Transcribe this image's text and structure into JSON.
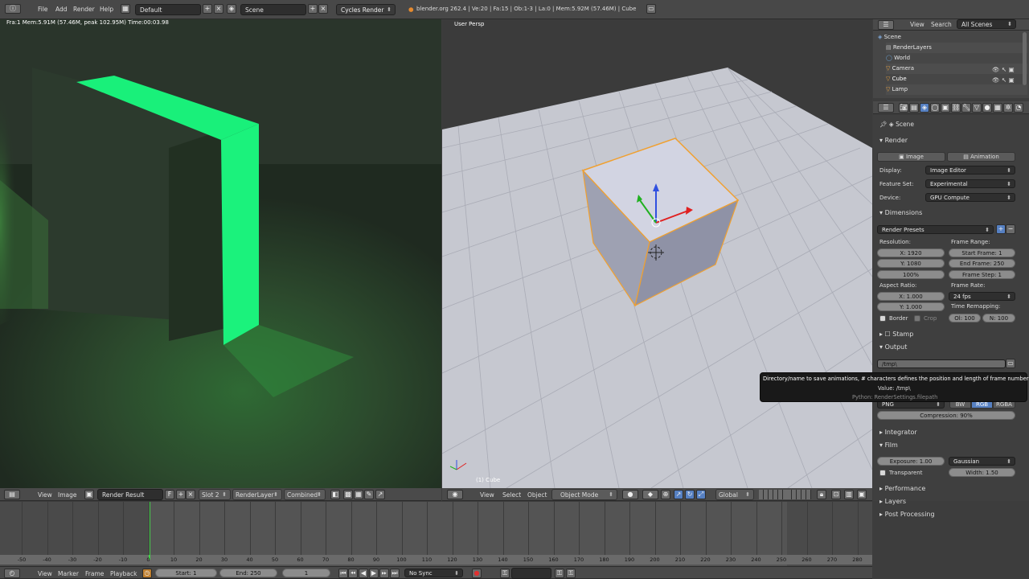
{
  "info_header": {
    "menus": [
      "File",
      "Add",
      "Render",
      "Help"
    ],
    "screen_layout": "Default",
    "scene": "Scene",
    "engine": "Cycles Render",
    "stats": "blender.org 262.4 | Ve:20 | Fa:15 | Ob:1-3 | La:0 | Mem:5.92M (57.46M) | Cube"
  },
  "image_editor": {
    "info_text": "Fra:1  Mem:5.91M (57.46M, peak 102.95M) Time:00:03.98",
    "menus": [
      "View",
      "Image"
    ],
    "image_name": "Render Result",
    "image_flag": "F",
    "slot": "Slot 2",
    "render_layer": "RenderLayer",
    "pass": "Combined"
  },
  "viewport": {
    "label": "User Persp",
    "object_label": "(1) Cube",
    "menus": [
      "View",
      "Select",
      "Object"
    ],
    "mode": "Object Mode",
    "orientation": "Global"
  },
  "outliner": {
    "menus": [
      "View",
      "Search"
    ],
    "filter": "All Scenes",
    "items": [
      "Scene",
      "RenderLayers",
      "World",
      "Camera",
      "Cube",
      "Lamp"
    ]
  },
  "properties": {
    "context": "Scene",
    "render": {
      "title": "Render",
      "image_btn": "Image",
      "animation_btn": "Animation",
      "display_label": "Display:",
      "display_value": "Image Editor",
      "feature_label": "Feature Set:",
      "feature_value": "Experimental",
      "device_label": "Device:",
      "device_value": "GPU Compute"
    },
    "dimensions": {
      "title": "Dimensions",
      "presets": "Render Presets",
      "resolution_label": "Resolution:",
      "res_x": "X: 1920",
      "res_y": "Y: 1080",
      "res_pct": "100%",
      "frame_range_label": "Frame Range:",
      "start_frame": "Start Frame: 1",
      "end_frame": "End Frame: 250",
      "frame_step": "Frame Step: 1",
      "aspect_label": "Aspect Ratio:",
      "aspect_x": "X: 1.000",
      "aspect_y": "Y: 1.000",
      "frame_rate_label": "Frame Rate:",
      "fps": "24 fps",
      "time_remap_label": "Time Remapping:",
      "remap_old": "Ol: 100",
      "remap_new": "N: 100",
      "border": "Border",
      "crop": "Crop"
    },
    "stamp": "Stamp",
    "output": {
      "title": "Output",
      "path": "/tmp\\",
      "format": "PNG",
      "bw": "BW",
      "rgb": "RGB",
      "rgba": "RGBA",
      "compression": "Compression: 90%"
    },
    "tooltip": {
      "line1": "Directory/name to save animations, # characters defines the position and length of frame numbers",
      "line2": "Value: /tmp\\",
      "line3": "Python: RenderSettings.filepath"
    },
    "integrator": "Integrator",
    "film": {
      "title": "Film",
      "exposure": "Exposure: 1.00",
      "filter": "Gaussian",
      "transparent": "Transparent",
      "width": "Width: 1.50"
    },
    "performance": "Performance",
    "layers": "Layers",
    "post_processing": "Post Processing"
  },
  "timeline": {
    "ticks": [
      "-50",
      "-40",
      "-30",
      "-20",
      "-10",
      "0",
      "10",
      "20",
      "30",
      "40",
      "50",
      "60",
      "70",
      "80",
      "90",
      "100",
      "110",
      "120",
      "130",
      "140",
      "150",
      "160",
      "170",
      "180",
      "190",
      "200",
      "210",
      "220",
      "230",
      "240",
      "250",
      "260",
      "270",
      "280"
    ],
    "menus": [
      "View",
      "Marker",
      "Frame",
      "Playback"
    ],
    "start": "Start: 1",
    "end": "End: 250",
    "current": "1",
    "sync": "No Sync"
  },
  "colors": {
    "accent_blue": "#5680c2",
    "render_green": "#19f07a",
    "selection_orange": "#f0a030"
  }
}
